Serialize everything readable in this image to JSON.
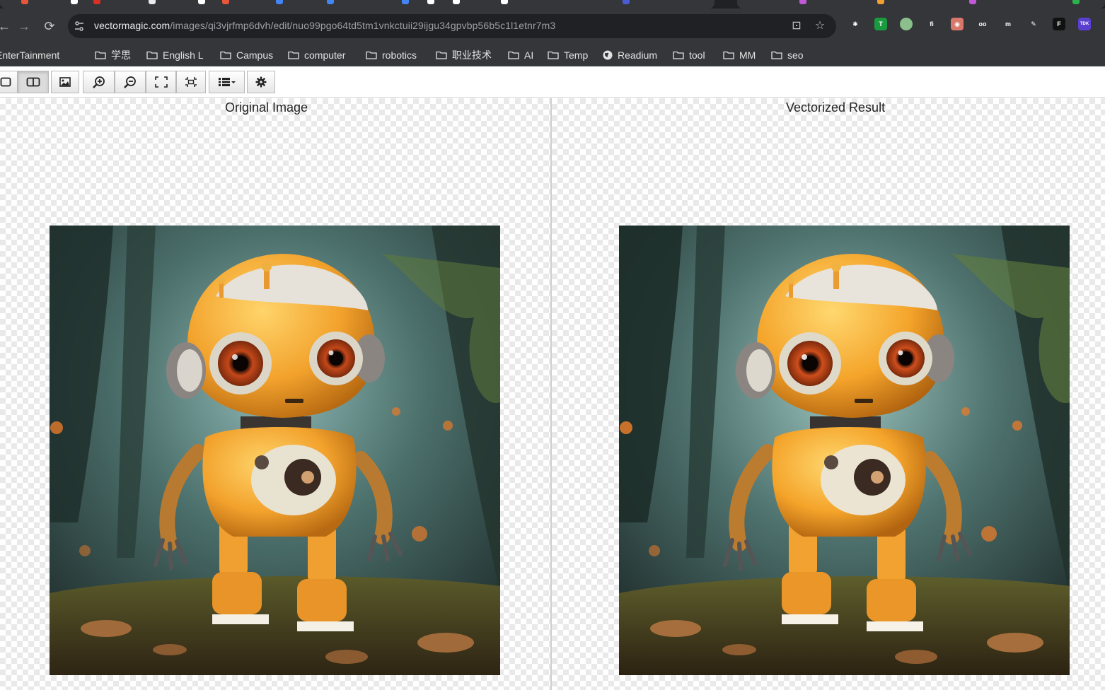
{
  "browser": {
    "url_host": "vectormagic.com",
    "url_path": "/images/qi3vjrfmp6dvh/edit/nuo99pgo64td5tm1vnkctuii29ijgu34gpvbp56b5c1l1etnr7m3",
    "bookmarks": [
      {
        "label": "EnterTainment",
        "icon": "folder-icon"
      },
      {
        "label": "学思",
        "icon": "folder-icon"
      },
      {
        "label": "English L",
        "icon": "folder-icon"
      },
      {
        "label": "Campus",
        "icon": "folder-icon"
      },
      {
        "label": "computer",
        "icon": "folder-icon"
      },
      {
        "label": "robotics",
        "icon": "folder-icon"
      },
      {
        "label": "职业技术",
        "icon": "folder-icon"
      },
      {
        "label": "AI",
        "icon": "folder-icon"
      },
      {
        "label": "Temp",
        "icon": "folder-icon"
      },
      {
        "label": "Readium",
        "icon": "globe-icon"
      },
      {
        "label": "tool",
        "icon": "folder-icon"
      },
      {
        "label": "MM",
        "icon": "folder-icon"
      },
      {
        "label": "seo",
        "icon": "folder-icon"
      }
    ],
    "extensions": [
      {
        "name": "asterisk-extension-icon",
        "glyph": "✱",
        "color": "#35363a"
      },
      {
        "name": "shield-t-extension-icon",
        "glyph": "T",
        "color": "#1a9a3f"
      },
      {
        "name": "circle-extension-icon",
        "glyph": "",
        "color": "#8bbf8b"
      },
      {
        "name": "fi-extension-icon",
        "glyph": "fi",
        "color": "#35363a"
      },
      {
        "name": "glasses-extension-icon",
        "glyph": "◉",
        "color": "#d9776b"
      },
      {
        "name": "oo-extension-icon",
        "glyph": "oo",
        "color": "#35363a"
      },
      {
        "name": "reader-extension-icon",
        "glyph": "m",
        "color": "#35363a"
      },
      {
        "name": "pen-extension-icon",
        "glyph": "✎",
        "color": "#35363a"
      },
      {
        "name": "f-extension-icon",
        "glyph": "F",
        "color": "#111111"
      },
      {
        "name": "tdk-extension-icon",
        "glyph": "TDK",
        "color": "#5b3fd0"
      }
    ]
  },
  "app": {
    "left_title": "Original Image",
    "right_title": "Vectorized Result",
    "toolbar": [
      "single-view-button",
      "split-view-button",
      "image-button",
      "zoom-in-button",
      "zoom-out-button",
      "fit-screen-button",
      "actual-size-button",
      "list-dropdown-button",
      "settings-button"
    ]
  },
  "colors": {
    "chrome_dark": "#202124",
    "chrome": "#35363a",
    "robot_orange": "#f2a22c",
    "forest": "#3e5a52"
  }
}
